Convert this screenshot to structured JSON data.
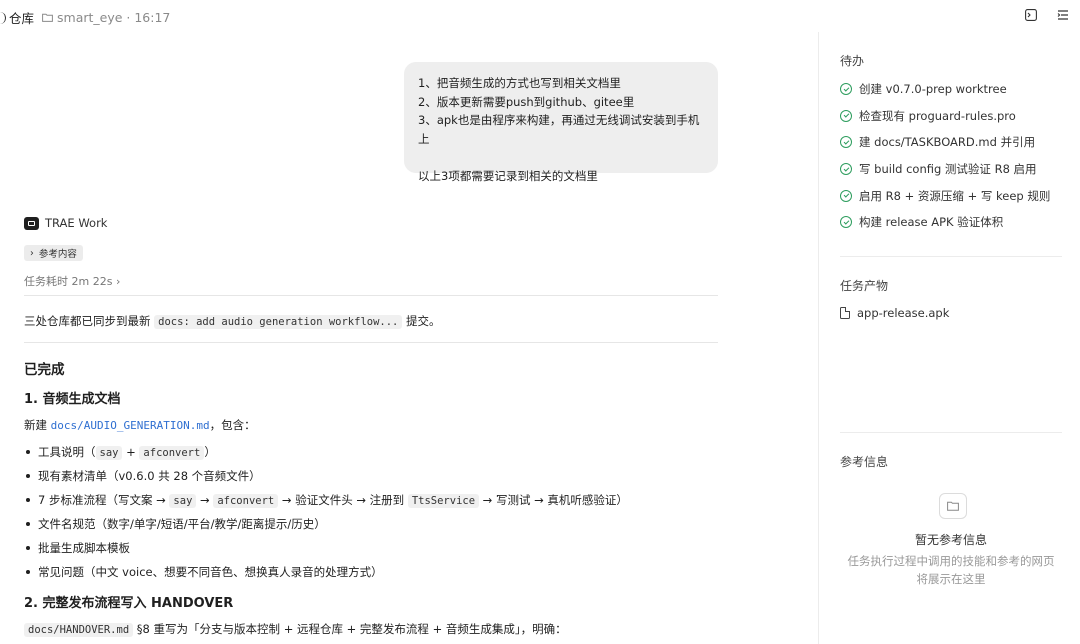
{
  "topbar": {
    "title": "仓库",
    "folder_name": "smart_eye",
    "time": "16:17",
    "actions": [
      "terminal-icon",
      "list-icon"
    ]
  },
  "user_message": {
    "lines": [
      "1、把音频生成的方式也写到相关文档里",
      "2、版本更新需要push到github、gitee里",
      "3、apk也是由程序来构建，再通过无线调试安装到手机上",
      "以上3项都需要记录到相关的文档里"
    ]
  },
  "agent": {
    "name": "TRAE Work",
    "ref_chip": "参考内容",
    "elapsed": "任务耗时 2m 22s"
  },
  "content": {
    "summary_prefix": "三处仓库都已同步到最新 ",
    "summary_code": "docs: add audio generation workflow...",
    "summary_suffix": " 提交。",
    "done_heading": "已完成",
    "section1_title": "1. 音频生成文档",
    "section1_intro_prefix": "新建 ",
    "section1_intro_link": "docs/AUDIO_GENERATION.md",
    "section1_intro_suffix": "，包含：",
    "bullets": {
      "b1_prefix": "工具说明（",
      "b1_code1": "say",
      "b1_mid": " + ",
      "b1_code2": "afconvert",
      "b1_suffix": "）",
      "b2": "现有素材清单（v0.6.0 共 28 个音频文件）",
      "b3_prefix": "7 步标准流程（写文案 → ",
      "b3_code1": "say",
      "b3_arrow1": " → ",
      "b3_code2": "afconvert",
      "b3_mid": " → 验证文件头 → 注册到 ",
      "b3_code3": "TtsService",
      "b3_suffix": " → 写测试 → 真机听感验证）",
      "b4": "文件名规范（数字/单字/短语/平台/教学/距离提示/历史）",
      "b5": "批量生成脚本模板",
      "b6": "常见问题（中文 voice、想要不同音色、想换真人录音的处理方式）"
    },
    "section2_title": "2. 完整发布流程写入 HANDOVER",
    "section2_code": "docs/HANDOVER.md",
    "section2_text": " §8 重写为「分支与版本控制 + 远程仓库 + 完整发布流程 + 音频生成集成」，明确："
  },
  "sidebar": {
    "todo_title": "待办",
    "todos": [
      "创建 v0.7.0-prep worktree",
      "检查现有 proguard-rules.pro",
      "建 docs/TASKBOARD.md 并引用",
      "写 build config 测试验证 R8 启用",
      "启用 R8 + 资源压缩 + 写 keep 规则",
      "构建 release APK 验证体积"
    ],
    "artifacts_title": "任务产物",
    "artifact_file": "app-release.apk",
    "ref_title": "参考信息",
    "empty_title": "暂无参考信息",
    "empty_desc_line1": "任务执行过程中调用的技能和参考的网页",
    "empty_desc_line2": "将展示在这里"
  }
}
